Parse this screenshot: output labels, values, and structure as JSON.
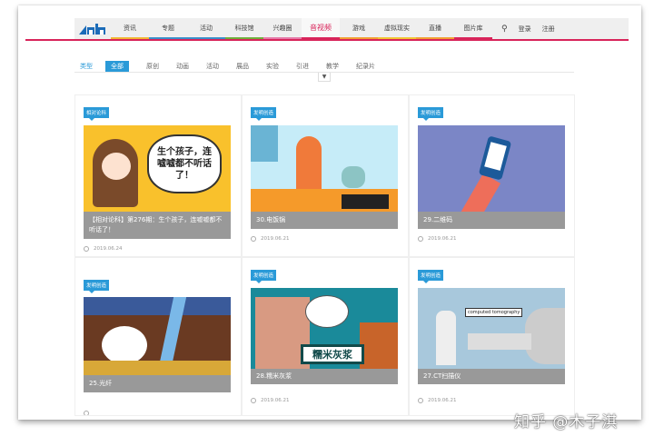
{
  "nav": {
    "items": [
      {
        "label": "资讯",
        "color": "#f2b632"
      },
      {
        "label": "专题",
        "color": "#3a8ec9"
      },
      {
        "label": "活动",
        "color": "#3a8ec9"
      },
      {
        "label": "科技馆",
        "color": "#6fae3a"
      },
      {
        "label": "兴趣圈",
        "color": "#e579a8"
      },
      {
        "label": "音视频",
        "color": "#d8245a",
        "active": true
      },
      {
        "label": "游戏",
        "color": "#f2a032"
      },
      {
        "label": "虚拟现实",
        "color": "#f2c532"
      },
      {
        "label": "直播",
        "color": "#f2a032"
      },
      {
        "label": "图片库",
        "color": "#d8245a"
      }
    ],
    "login": "登录",
    "register": "注册"
  },
  "filter": {
    "label": "类型",
    "items": [
      "全部",
      "原创",
      "动画",
      "活动",
      "展品",
      "实验",
      "引进",
      "教学",
      "纪录片"
    ],
    "selected": "全部"
  },
  "cards": [
    {
      "tag": "相对论科",
      "title": "【相对论科】第276期：生个孩子，连嘘嘘都不听话了！",
      "date": "2019.06.24",
      "image_text": "生个孩子，连嘘嘘都不听话了！"
    },
    {
      "tag": "发明创造",
      "title": "30.电饭锅",
      "date": "2019.06.21"
    },
    {
      "tag": "发明创造",
      "title": "29.二维码",
      "date": "2019.06.21"
    },
    {
      "tag": "发明创造",
      "title": "25.光纤",
      "date": ""
    },
    {
      "tag": "发明创造",
      "title": "28.糯米灰浆",
      "date": "2019.06.21",
      "image_text": "糯米灰浆"
    },
    {
      "tag": "发明创造",
      "title": "27.CT扫描仪",
      "date": "2019.06.21",
      "image_text": "computed tomography"
    }
  ],
  "watermark": "知乎 @木子淇",
  "accent": "#2a9ad8"
}
